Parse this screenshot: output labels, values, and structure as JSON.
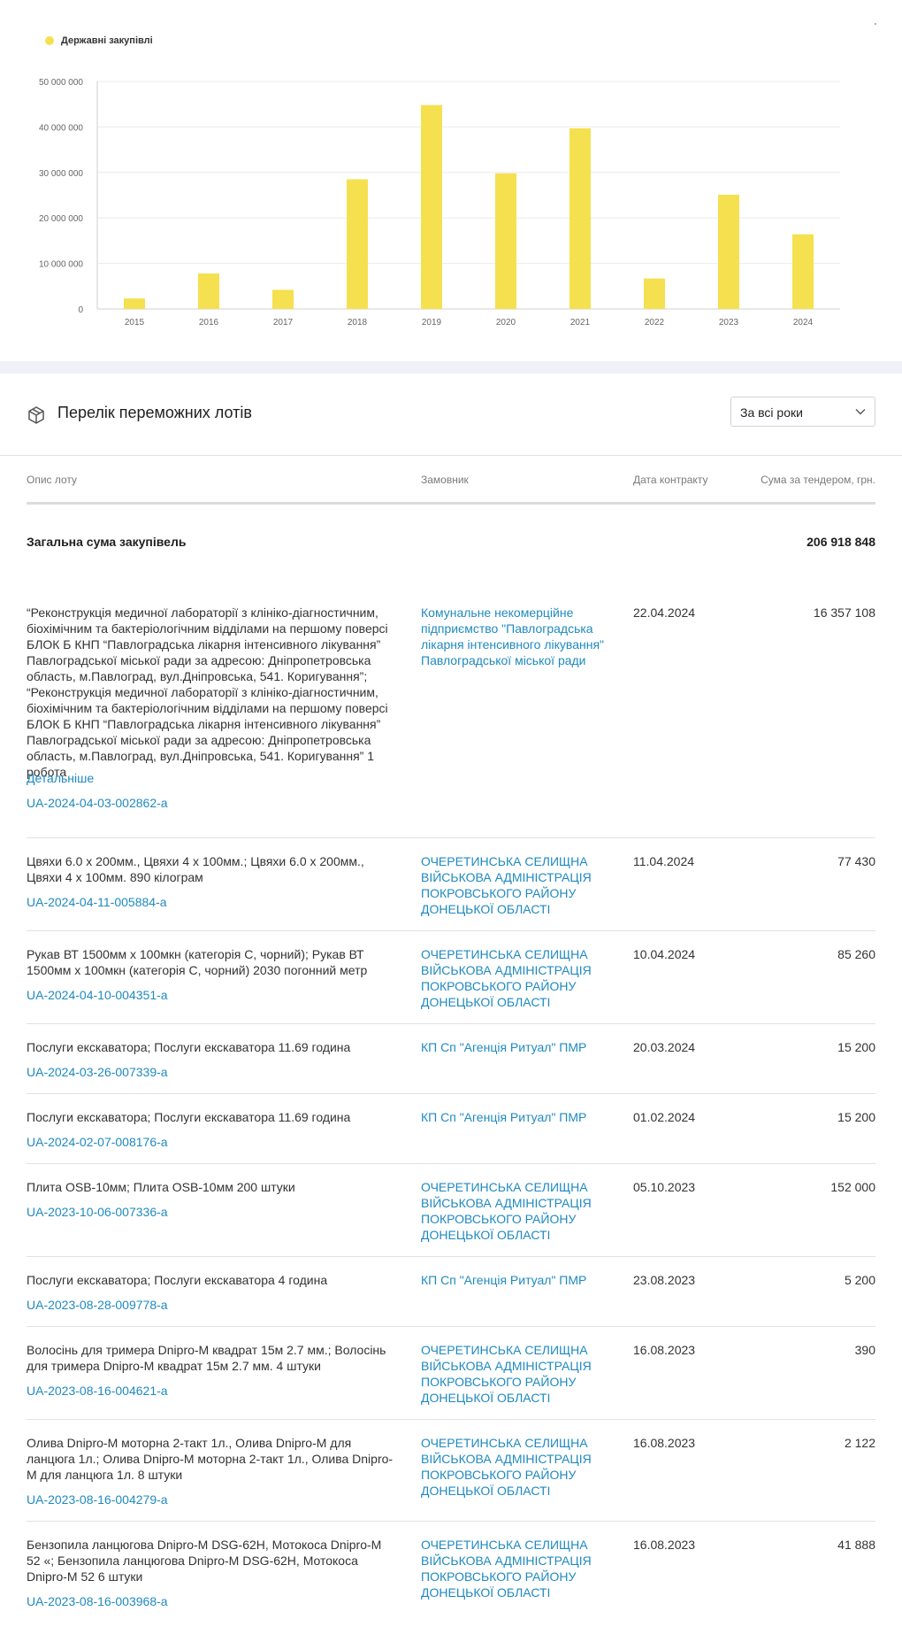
{
  "chart_data": {
    "type": "bar",
    "categories": [
      "2015",
      "2016",
      "2017",
      "2018",
      "2019",
      "2020",
      "2021",
      "2022",
      "2023",
      "2024"
    ],
    "series": [
      {
        "name": "Державні закупівлі",
        "values": [
          2300000,
          7800000,
          4200000,
          28500000,
          44800000,
          29800000,
          39700000,
          6700000,
          25100000,
          16400000
        ]
      }
    ],
    "ylim": [
      0,
      50000000
    ],
    "yticks": [
      "0",
      "10 000 000",
      "20 000 000",
      "30 000 000",
      "40 000 000",
      "50 000 000"
    ],
    "grid": true,
    "legend": "top-left",
    "color": "#f5e050"
  },
  "lots": {
    "title": "Перелік переможних лотів",
    "icon": "box-icon",
    "filter": {
      "selected": "За всі роки"
    },
    "columns": {
      "description": "Опис лоту",
      "customer": "Замовник",
      "date": "Дата контракту",
      "sum": "Сума за тендером, грн."
    },
    "total": {
      "label": "Загальна сума закупівель",
      "value": "206 918 848"
    },
    "rows": [
      {
        "description": "“Реконструкція медичної лабораторії з клініко-діагностичним, біохімічним та бактеріологічним відділами на першому поверсі БЛОК Б КНП “Павлоградська лікарня інтенсивного лікування” Павлоградської міської ради за адресою: Дніпропетровська область, м.Павлоград, вул.Дніпровська, 541. Коригування”; “Реконструкція медичної лабораторії з клініко-діагностичним, біохімічним та бактеріологічним відділами на першому поверсі БЛОК Б КНП “Павлоградська лікарня інтенсивного лікування” Павлоградської міської ради за адресою: Дніпропетровська область, м.Павлоград, вул.Дніпровська, 541. Коригування” 1 робота",
        "details": "Детальніше",
        "id": "UA-2024-04-03-002862-a",
        "customer": "Комунальне некомерційне підприємство \"Павлоградська лікарня інтенсивного лікування\" Павлоградської міської ради",
        "date": "22.04.2024",
        "sum": "16 357 108"
      },
      {
        "description": "Цвяхи 6.0 х 200мм., Цвяхи 4 х 100мм.; Цвяхи 6.0 х 200мм., Цвяхи 4 х 100мм. 890 кілограм",
        "id": "UA-2024-04-11-005884-a",
        "customer": "ОЧЕРЕТИНСЬКА СЕЛИЩНА ВІЙСЬКОВА АДМІНІСТРАЦІЯ ПОКРОВСЬКОГО РАЙОНУ ДОНЕЦЬКОЇ ОБЛАСТІ",
        "date": "11.04.2024",
        "sum": "77 430"
      },
      {
        "description": "Рукав ВТ 1500мм х 100мкн (категорія С, чорний); Рукав ВТ 1500мм х 100мкн (категорія С, чорний) 2030 погонний метр",
        "id": "UA-2024-04-10-004351-a",
        "customer": "ОЧЕРЕТИНСЬКА СЕЛИЩНА ВІЙСЬКОВА АДМІНІСТРАЦІЯ ПОКРОВСЬКОГО РАЙОНУ ДОНЕЦЬКОЇ ОБЛАСТІ",
        "date": "10.04.2024",
        "sum": "85 260"
      },
      {
        "description": "Послуги екскаватора; Послуги екскаватора 11.69 година",
        "id": "UA-2024-03-26-007339-a",
        "customer": "КП Сп \"Агенція Ритуал\" ПМР",
        "date": "20.03.2024",
        "sum": "15 200"
      },
      {
        "description": "Послуги екскаватора; Послуги екскаватора 11.69 година",
        "id": "UA-2024-02-07-008176-a",
        "customer": "КП Сп \"Агенція Ритуал\" ПМР",
        "date": "01.02.2024",
        "sum": "15 200"
      },
      {
        "description": "Плита OSB-10мм; Плита OSB-10мм 200 штуки",
        "id": "UA-2023-10-06-007336-a",
        "customer": "ОЧЕРЕТИНСЬКА СЕЛИЩНА ВІЙСЬКОВА АДМІНІСТРАЦІЯ ПОКРОВСЬКОГО РАЙОНУ ДОНЕЦЬКОЇ ОБЛАСТІ",
        "date": "05.10.2023",
        "sum": "152 000"
      },
      {
        "description": "Послуги екскаватора; Послуги екскаватора 4 година",
        "id": "UA-2023-08-28-009778-a",
        "customer": "КП Сп \"Агенція Ритуал\" ПМР",
        "date": "23.08.2023",
        "sum": "5 200"
      },
      {
        "description": "Волосінь для тримера Dnipro-M квадрат 15м 2.7 мм.; Волосінь для тримера Dnipro-M квадрат 15м 2.7 мм. 4 штуки",
        "id": "UA-2023-08-16-004621-a",
        "customer": "ОЧЕРЕТИНСЬКА СЕЛИЩНА ВІЙСЬКОВА АДМІНІСТРАЦІЯ ПОКРОВСЬКОГО РАЙОНУ ДОНЕЦЬКОЇ ОБЛАСТІ",
        "date": "16.08.2023",
        "sum": "390"
      },
      {
        "description": "Олива Dnipro-M моторна 2-такт 1л., Олива Dnipro-M для ланцюга 1л.; Олива Dnipro-M моторна 2-такт 1л., Олива Dnipro-M для ланцюга 1л. 8 штуки",
        "id": "UA-2023-08-16-004279-a",
        "customer": "ОЧЕРЕТИНСЬКА СЕЛИЩНА ВІЙСЬКОВА АДМІНІСТРАЦІЯ ПОКРОВСЬКОГО РАЙОНУ ДОНЕЦЬКОЇ ОБЛАСТІ",
        "date": "16.08.2023",
        "sum": "2 122"
      },
      {
        "description": "Бензопила ланцюгова Dnipro-M DSG-62H, Мотокоса Dnipro-M 52 «; Бензопила ланцюгова Dnipro-M DSG-62H, Мотокоса Dnipro-M 52 6 штуки",
        "id": "UA-2023-08-16-003968-a",
        "customer": "ОЧЕРЕТИНСЬКА СЕЛИЩНА ВІЙСЬКОВА АДМІНІСТРАЦІЯ ПОКРОВСЬКОГО РАЙОНУ ДОНЕЦЬКОЇ ОБЛАСТІ",
        "date": "16.08.2023",
        "sum": "41 888"
      }
    ]
  }
}
